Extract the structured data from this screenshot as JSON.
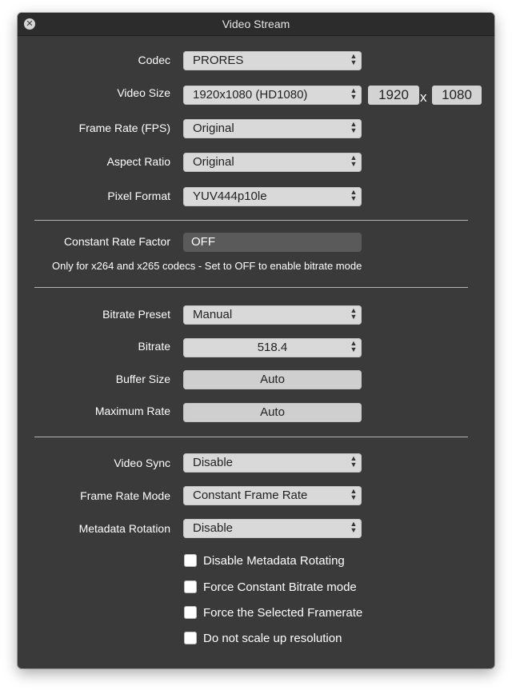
{
  "window": {
    "title": "Video Stream"
  },
  "fields": {
    "codec": {
      "label": "Codec",
      "value": "PRORES"
    },
    "video_size": {
      "label": "Video Size",
      "value": "1920x1080 (HD1080)",
      "width": "1920",
      "separator": "x",
      "height": "1080"
    },
    "frame_rate": {
      "label": "Frame Rate (FPS)",
      "value": "Original"
    },
    "aspect_ratio": {
      "label": "Aspect Ratio",
      "value": "Original"
    },
    "pixel_format": {
      "label": "Pixel Format",
      "value": "YUV444p10le"
    },
    "crf": {
      "label": "Constant Rate Factor",
      "value": "OFF",
      "note": "Only for x264 and x265 codecs  -  Set to OFF to enable bitrate mode"
    },
    "bitrate_preset": {
      "label": "Bitrate Preset",
      "value": "Manual"
    },
    "bitrate": {
      "label": "Bitrate",
      "value": "518.4"
    },
    "buffer_size": {
      "label": "Buffer Size",
      "value": "Auto"
    },
    "maximum_rate": {
      "label": "Maximum Rate",
      "value": "Auto"
    },
    "video_sync": {
      "label": "Video Sync",
      "value": "Disable"
    },
    "frame_rate_mode": {
      "label": "Frame Rate Mode",
      "value": "Constant Frame Rate"
    },
    "metadata_rotation": {
      "label": "Metadata Rotation",
      "value": "Disable"
    }
  },
  "checkboxes": [
    {
      "label": "Disable Metadata Rotating",
      "checked": false
    },
    {
      "label": "Force Constant Bitrate mode",
      "checked": false
    },
    {
      "label": "Force the Selected Framerate",
      "checked": false
    },
    {
      "label": "Do not scale up resolution",
      "checked": false
    }
  ],
  "icons": {
    "close": "close-icon",
    "stepper": "chevron-up-down-icon"
  }
}
